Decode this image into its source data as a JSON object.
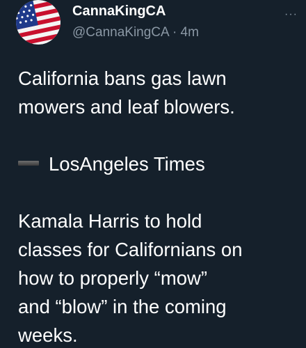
{
  "tweet": {
    "display_name": "CannaKingCA",
    "handle": "@CannaKingCA",
    "separator": "·",
    "time": "4m",
    "more_icon": "more-horizontal-icon",
    "avatar_icon": "us-flag-icon",
    "paragraphs": [
      [
        "California bans gas lawn",
        "mowers and leaf blowers."
      ],
      [
        "LosAngeles Times"
      ],
      [
        "Kamala Harris to hold",
        "classes for Californians on",
        "how to properly “mow”",
        "and “blow” in the coming",
        "weeks."
      ]
    ],
    "source_icon": "black-dash-icon"
  },
  "colors": {
    "background": "#15202b",
    "text_primary": "#ffffff",
    "text_secondary": "#8b98a5"
  }
}
